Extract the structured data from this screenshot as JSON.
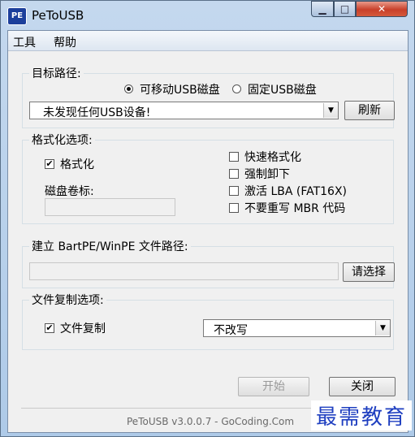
{
  "window": {
    "title": "PeToUSB",
    "icon_text": "PE"
  },
  "menu": {
    "items": [
      "工具",
      "帮助"
    ]
  },
  "target": {
    "group_label": "目标路径:",
    "radio_removable": "可移动USB磁盘",
    "radio_fixed": "固定USB磁盘",
    "selected": "removable",
    "device_value": "未发现任何USB设备!",
    "refresh_label": "刷新"
  },
  "format": {
    "group_label": "格式化选项:",
    "format_label": "格式化",
    "format_checked": true,
    "volume_label": "磁盘卷标:",
    "volume_value": "",
    "quick_format": "快速格式化",
    "force_unmount": "强制卸下",
    "enable_lba": "激活 LBA (FAT16X)",
    "no_mbr": "不要重写 MBR 代码"
  },
  "bartpe": {
    "group_label": "建立 BartPE/WinPE 文件路径:",
    "path_value": "",
    "browse_label": "请选择"
  },
  "copy": {
    "group_label": "文件复制选项:",
    "copy_label": "文件复制",
    "copy_checked": true,
    "mode_value": "不改写"
  },
  "actions": {
    "start_label": "开始",
    "close_label": "关闭"
  },
  "footer": {
    "text": "PeToUSB v3.0.0.7 - GoCoding.Com"
  },
  "watermark": {
    "text": "最需教育"
  },
  "colors": {
    "title_bar": "#b8d0ea",
    "close_button": "#c8402a",
    "client_bg": "#f0f0f0",
    "watermark": "#1f3fc0"
  }
}
